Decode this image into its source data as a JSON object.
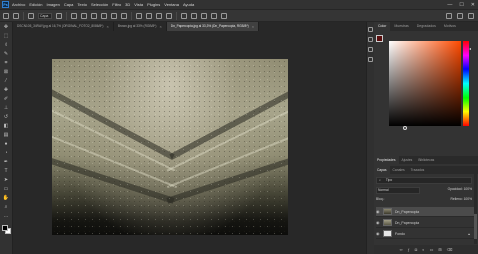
{
  "app": {
    "logo": "Ps"
  },
  "menubar": {
    "items": [
      "Archivo",
      "Edición",
      "Imagen",
      "Capa",
      "Texto",
      "Selección",
      "Filtro",
      "3D",
      "Vista",
      "Plugins",
      "Ventana",
      "Ayuda"
    ]
  },
  "window_controls": {
    "minimize": "—",
    "maximize": "☐",
    "close": "✕"
  },
  "options_bar": {
    "mode_label": "Capa",
    "right_icons": [
      "search-icon",
      "workspace-icon",
      "share-icon"
    ]
  },
  "tabs": [
    {
      "label": "DSCN105_34RAY.jpg al 16,7% (ORGINAL_FOTO2_8086/8*)",
      "active": false
    },
    {
      "label": "Brown.jpg al 33% (RGB/8*)",
      "active": false
    },
    {
      "label": "Dn_Papercopia.jpg al 33,3% (Dn_Papercopia, RGB/8*)",
      "active": true
    }
  ],
  "toolbar": {
    "tools": [
      "move-icon",
      "marquee-icon",
      "lasso-icon",
      "quick-select-icon",
      "crop-icon",
      "frame-icon",
      "eyedropper-icon",
      "healing-icon",
      "brush-icon",
      "stamp-icon",
      "history-brush-icon",
      "eraser-icon",
      "gradient-icon",
      "blur-icon",
      "dodge-icon",
      "pen-icon",
      "type-icon",
      "path-select-icon",
      "shape-icon",
      "hand-icon",
      "zoom-icon",
      "more-icon"
    ]
  },
  "color_panel": {
    "tabs": [
      "Color",
      "Muestras",
      "Degradados",
      "Motivos"
    ],
    "active_tab": "Color",
    "foreground": "#5a0e0e",
    "background": "#e8e8e8",
    "hue_color": "#ff4a00"
  },
  "properties_tabs": [
    "Propiedades",
    "Ajustes",
    "Bibliotecas"
  ],
  "layers_panel": {
    "tabs": [
      "Capas",
      "Canales",
      "Trazados"
    ],
    "active_tab": "Capas",
    "filter_label": "Tipo",
    "blend_mode": "Normal",
    "opacity_label": "Opacidad:",
    "opacity": "100%",
    "lock_label": "Bloq.:",
    "fill_label": "Relleno:",
    "fill": "100%",
    "layers": [
      {
        "name": "Dn_Papercopia",
        "selected": true
      },
      {
        "name": "Dn_Papercopia",
        "selected": false
      },
      {
        "name": "Fondo",
        "selected": false,
        "locked": true
      }
    ],
    "footer_icons": [
      "link-icon",
      "fx-icon",
      "mask-icon",
      "adjustment-icon",
      "group-icon",
      "new-layer-icon",
      "trash-icon"
    ]
  }
}
